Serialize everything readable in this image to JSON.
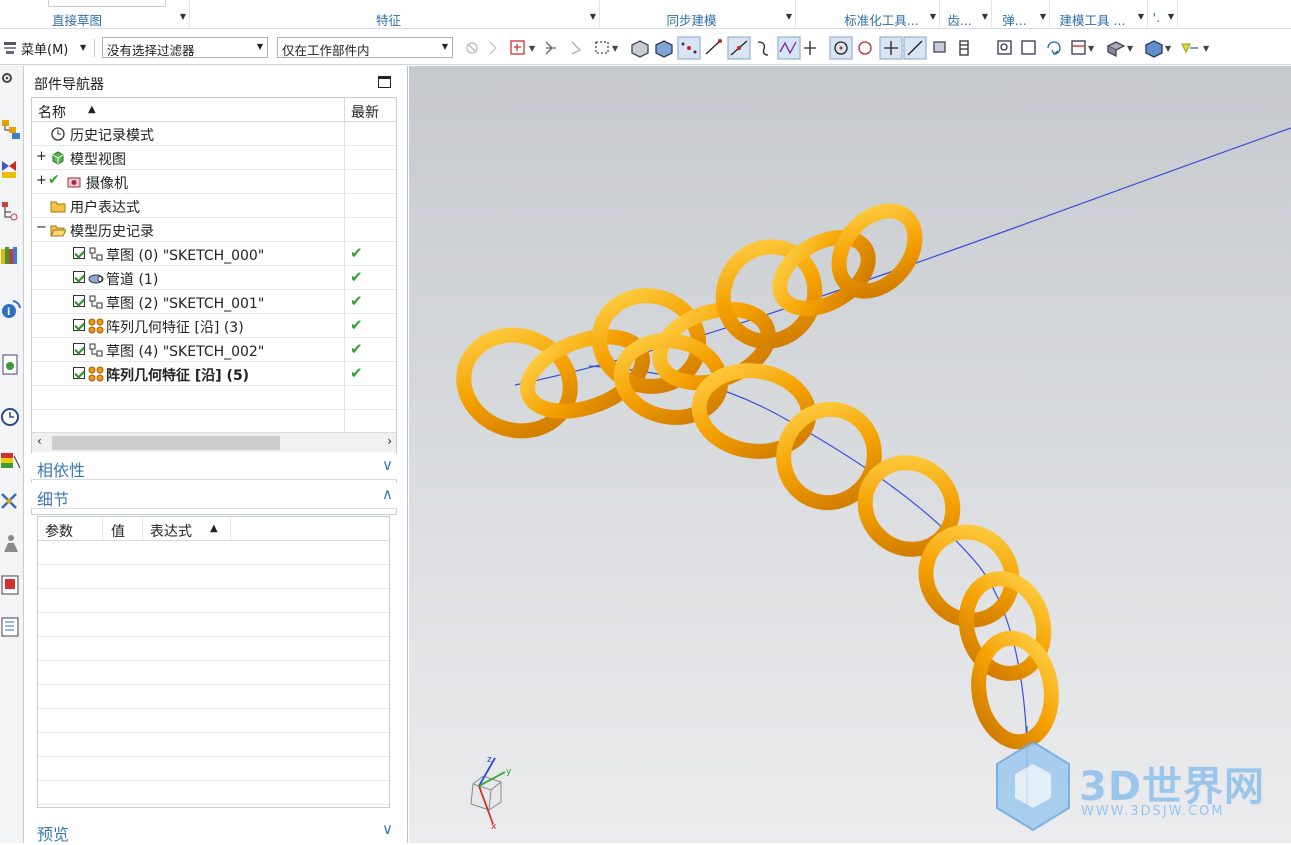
{
  "ribbon": {
    "groups": [
      {
        "label": "直接草图"
      },
      {
        "label": "特征"
      },
      {
        "label": "同步建模"
      },
      {
        "label": "标准化工具..."
      },
      {
        "label": "齿..."
      },
      {
        "label": "弹..."
      },
      {
        "label": "建模工具 ..."
      },
      {
        "label": "'."
      }
    ]
  },
  "toolbar": {
    "menu_label": "菜单(M)",
    "filter_select": "没有选择过滤器",
    "scope_select": "仅在工作部件内"
  },
  "navigator": {
    "title": "部件导航器",
    "col_name": "名称",
    "col_latest": "最新",
    "items": [
      {
        "label": "历史记录模式",
        "bold": false,
        "check": false,
        "latest": ""
      },
      {
        "label": "模型视图",
        "bold": false,
        "check": false,
        "latest": ""
      },
      {
        "label": "摄像机",
        "bold": false,
        "check": false,
        "latest": ""
      },
      {
        "label": "用户表达式",
        "bold": false,
        "check": false,
        "latest": ""
      },
      {
        "label": "模型历史记录",
        "bold": false,
        "check": false,
        "latest": ""
      },
      {
        "label": "草图 (0) \"SKETCH_000\"",
        "bold": false,
        "check": true,
        "latest": "✔"
      },
      {
        "label": "管道 (1)",
        "bold": false,
        "check": true,
        "latest": "✔"
      },
      {
        "label": "草图 (2) \"SKETCH_001\"",
        "bold": false,
        "check": true,
        "latest": "✔"
      },
      {
        "label": "阵列几何特征 [沿] (3)",
        "bold": false,
        "check": true,
        "latest": "✔"
      },
      {
        "label": "草图 (4) \"SKETCH_002\"",
        "bold": false,
        "check": true,
        "latest": "✔"
      },
      {
        "label": "阵列几何特征 [沿] (5)",
        "bold": true,
        "check": true,
        "latest": "✔"
      }
    ]
  },
  "sections": {
    "dependency": "相依性",
    "detail": "细节",
    "preview": "预览"
  },
  "detail_table": {
    "col_param": "参数",
    "col_value": "值",
    "col_expr": "表达式"
  },
  "watermark": {
    "brand": "3D世界网",
    "url": "WWW.3DSJW.COM"
  },
  "colors": {
    "chain": "#f5a000",
    "curve": "#3b4fd8",
    "accent": "#2f6fa8"
  }
}
